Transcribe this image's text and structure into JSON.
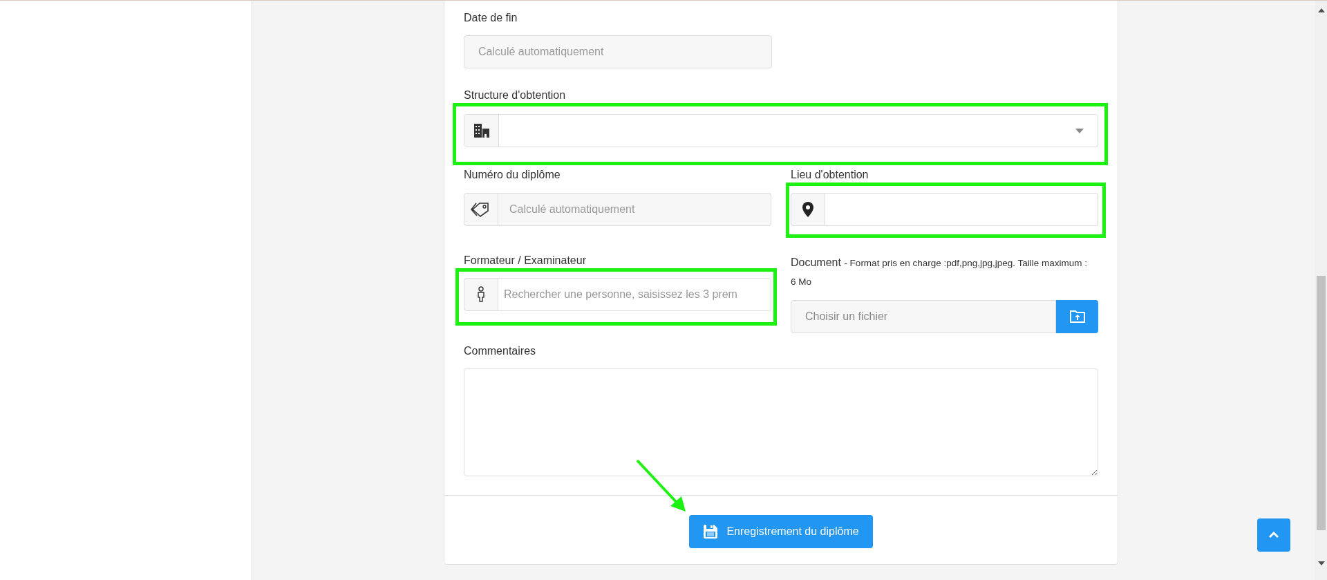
{
  "form": {
    "date_fin": {
      "label": "Date de fin",
      "placeholder": "Calculé automatiquement"
    },
    "structure": {
      "label": "Structure d'obtention"
    },
    "numero": {
      "label": "Numéro du diplôme",
      "placeholder": "Calculé automatiquement"
    },
    "lieu": {
      "label": "Lieu d'obtention"
    },
    "formateur": {
      "label": "Formateur / Examinateur",
      "placeholder": "Rechercher une personne, saisissez les 3 prem"
    },
    "document": {
      "label": "Document",
      "hint": "- Format pris en charge :pdf,png,jpg,jpeg. Taille maximum : 6 Mo",
      "placeholder": "Choisir un fichier"
    },
    "commentaires": {
      "label": "Commentaires"
    },
    "submit": "Enregistrement du diplôme"
  }
}
